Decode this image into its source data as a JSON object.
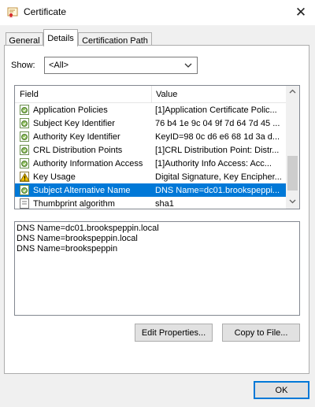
{
  "window": {
    "title": "Certificate",
    "icons": {
      "app": "certificate-icon",
      "close": "close-icon"
    }
  },
  "tabs": [
    {
      "label": "General",
      "active": false
    },
    {
      "label": "Details",
      "active": true
    },
    {
      "label": "Certification Path",
      "active": false
    }
  ],
  "show": {
    "label": "Show:",
    "selected": "<All>"
  },
  "fields_table": {
    "headers": {
      "field": "Field",
      "value": "Value"
    },
    "rows": [
      {
        "field": "Application Policies",
        "value": "[1]Application Certificate Polic...",
        "icon": "extension-icon",
        "selected": false
      },
      {
        "field": "Subject Key Identifier",
        "value": "76 b4 1e 9c 04 9f 7d 64 7d 45 ...",
        "icon": "extension-icon",
        "selected": false
      },
      {
        "field": "Authority Key Identifier",
        "value": "KeyID=98 0c d6 e6 68 1d 3a d...",
        "icon": "extension-icon",
        "selected": false
      },
      {
        "field": "CRL Distribution Points",
        "value": "[1]CRL Distribution Point: Distr...",
        "icon": "extension-icon",
        "selected": false
      },
      {
        "field": "Authority Information Access",
        "value": "[1]Authority Info Access: Acc...",
        "icon": "extension-icon",
        "selected": false
      },
      {
        "field": "Key Usage",
        "value": "Digital Signature, Key Encipher...",
        "icon": "critical-extension-icon",
        "selected": false
      },
      {
        "field": "Subject Alternative Name",
        "value": "DNS Name=dc01.brookspeppi...",
        "icon": "extension-icon",
        "selected": true
      },
      {
        "field": "Thumbprint algorithm",
        "value": "sha1",
        "icon": "property-icon",
        "selected": false
      }
    ]
  },
  "detail": {
    "lines": [
      "DNS Name=dc01.brookspeppin.local",
      "DNS Name=brookspeppin.local",
      "DNS Name=brookspeppin"
    ]
  },
  "buttons": {
    "edit_properties": "Edit Properties...",
    "copy_to_file": "Copy to File...",
    "ok": "OK"
  },
  "colors": {
    "selection": "#0078d7",
    "dialog_bg": "#f0f0f0",
    "default_button_border": "#0078d7"
  }
}
